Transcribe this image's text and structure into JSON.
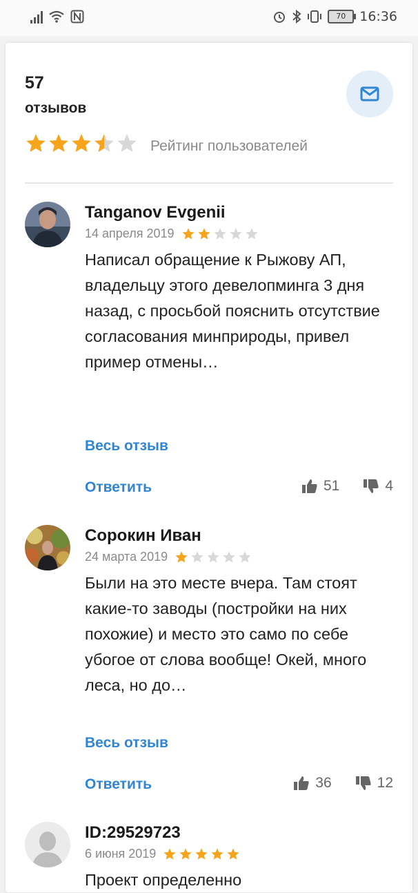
{
  "status_bar": {
    "battery": "70",
    "time": "16:36",
    "icons": [
      "signal-icon",
      "wifi-icon",
      "nfc-icon",
      "alarm-icon",
      "bluetooth-icon",
      "vibrate-icon",
      "battery-icon"
    ]
  },
  "summary": {
    "count": "57",
    "count_label": "отзывов",
    "rating": 3.5,
    "rating_label": "Рейтинг пользователей"
  },
  "labels": {
    "read_more": "Весь отзыв",
    "reply": "Ответить"
  },
  "reviews": [
    {
      "author": "Tanganov Evgenii",
      "date": "14 апреля 2019",
      "stars": 2,
      "text": "Написал обращение к Рыжову АП, владельцу этого девелопминга 3 дня назад, с просьбой пояснить отсутствие согласования минприроды, привел пример отмены…",
      "likes": "51",
      "dislikes": "4"
    },
    {
      "author": "Сорокин Иван",
      "date": "24 марта 2019",
      "stars": 1,
      "text": "Были на это месте вчера. Там стоят какие-то заводы (постройки на них похожие) и место это само по себе убогое от слова вообще! Окей, много леса, но до…",
      "likes": "36",
      "dislikes": "12"
    },
    {
      "author": "ID:29529723",
      "date": "6 июня 2019",
      "stars": 5,
      "text": "Проект определенно"
    }
  ],
  "colors": {
    "star_on": "#f7a41d",
    "star_off": "#d8d8d8",
    "link": "#2f86d6",
    "mail_bg": "#e3eef9"
  }
}
